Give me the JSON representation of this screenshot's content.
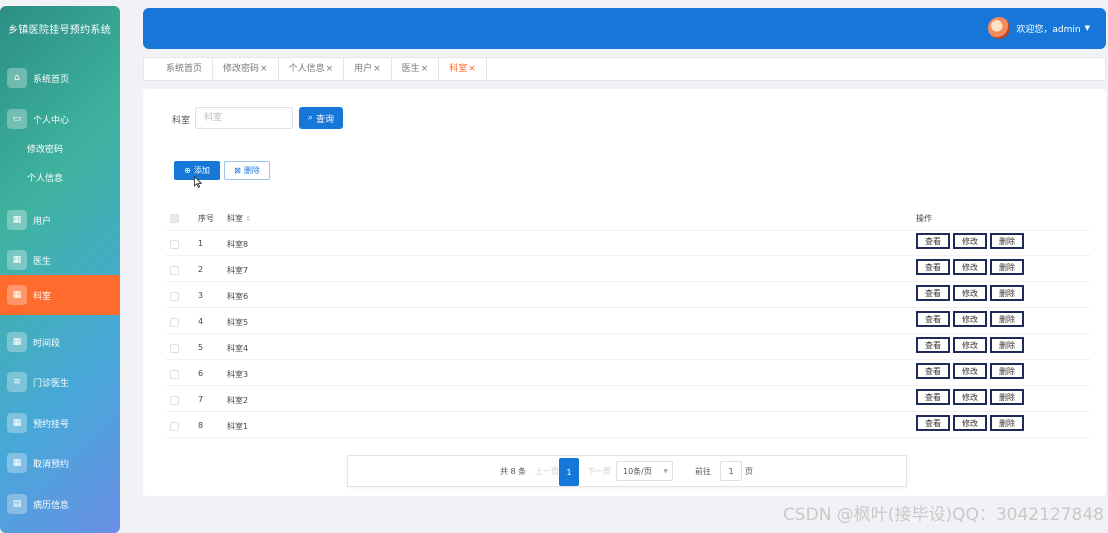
{
  "app_title": "乡镇医院挂号预约系统",
  "sidebar": {
    "items": [
      {
        "label": "系统首页",
        "icon": "home-icon"
      },
      {
        "label": "个人中心",
        "icon": "card-icon"
      },
      {
        "label": "用户",
        "icon": "grid-icon"
      },
      {
        "label": "医生",
        "icon": "grid-icon"
      },
      {
        "label": "科室",
        "icon": "grid-icon",
        "active": true
      },
      {
        "label": "时间段",
        "icon": "grid-icon"
      },
      {
        "label": "门诊医生",
        "icon": "list-icon"
      },
      {
        "label": "预约挂号",
        "icon": "grid-icon"
      },
      {
        "label": "取消预约",
        "icon": "grid-icon"
      },
      {
        "label": "病历信息",
        "icon": "table-icon"
      }
    ],
    "submenu": [
      "修改密码",
      "个人信息"
    ]
  },
  "header": {
    "welcome": "欢迎您，admin"
  },
  "tabs": [
    {
      "label": "系统首页",
      "close": ""
    },
    {
      "label": "修改密码",
      "close": "×"
    },
    {
      "label": "个人信息",
      "close": "×"
    },
    {
      "label": "用户",
      "close": "×"
    },
    {
      "label": "医生",
      "close": "×"
    },
    {
      "label": "科室",
      "close": "×",
      "active": true
    }
  ],
  "search": {
    "label": "科室",
    "placeholder": "科室",
    "button": "查询"
  },
  "toolbar": {
    "add": "添加",
    "delete": "删除"
  },
  "table": {
    "headers": {
      "index": "序号",
      "name": "科室",
      "ops": "操作"
    },
    "rows": [
      {
        "index": "1",
        "name": "科室8"
      },
      {
        "index": "2",
        "name": "科室7"
      },
      {
        "index": "3",
        "name": "科室6"
      },
      {
        "index": "4",
        "name": "科室5"
      },
      {
        "index": "5",
        "name": "科室4"
      },
      {
        "index": "6",
        "name": "科室3"
      },
      {
        "index": "7",
        "name": "科室2"
      },
      {
        "index": "8",
        "name": "科室1"
      }
    ],
    "op_labels": [
      "查看",
      "修改",
      "删除"
    ]
  },
  "pagination": {
    "total": "共 8 条",
    "prev": "上一页",
    "current": "1",
    "next": "下一页",
    "page_size": "10条/页",
    "goto": "前往",
    "goto_value": "1",
    "page_unit": "页"
  },
  "watermark": "CSDN @枫叶(接毕设)QQ：3042127848",
  "colors": {
    "primary": "#1677d9",
    "active": "#ff6b2c"
  }
}
